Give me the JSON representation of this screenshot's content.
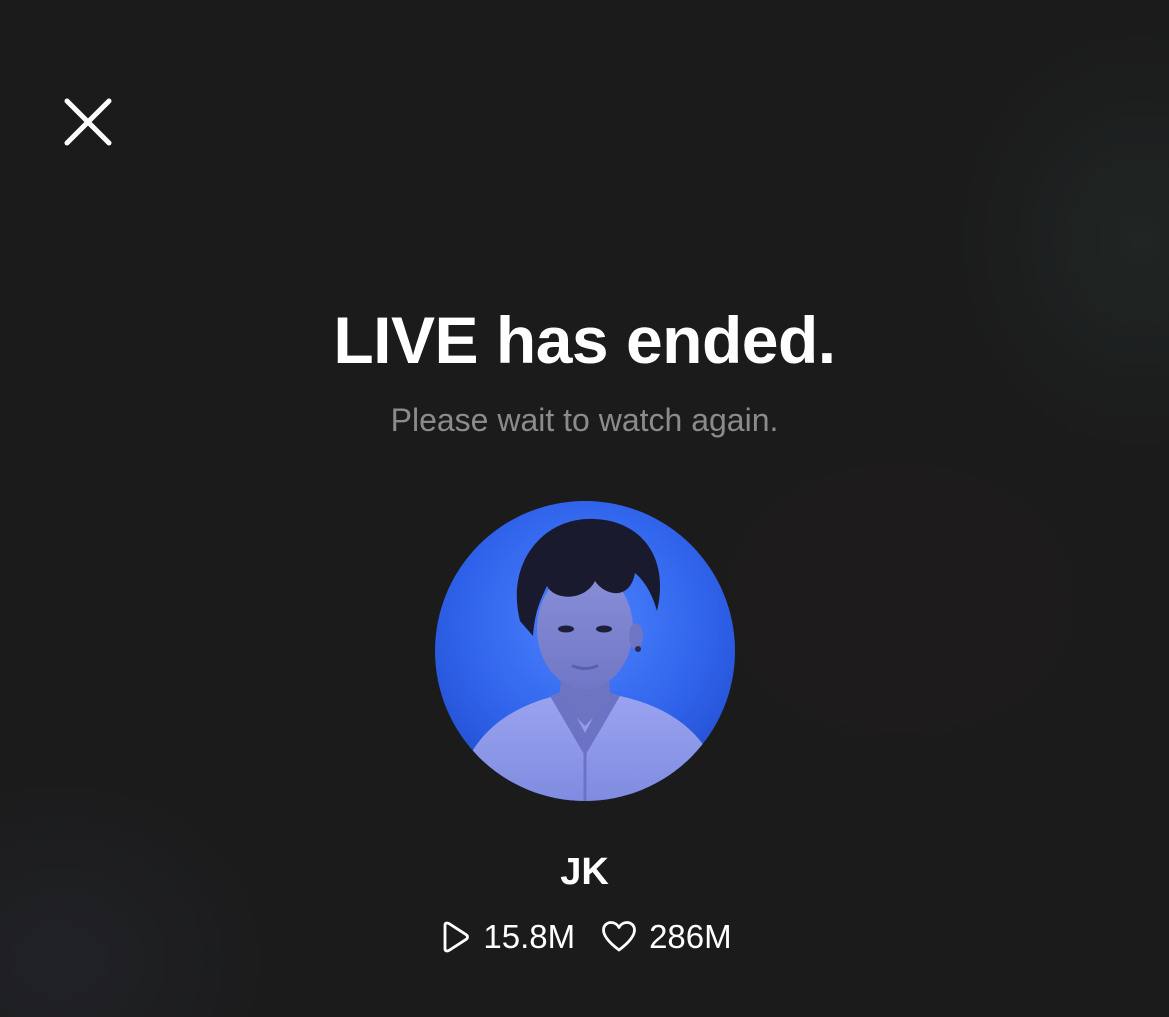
{
  "header": {
    "close_icon": "close-icon"
  },
  "main": {
    "title": "LIVE has ended.",
    "subtitle": "Please wait to watch again."
  },
  "profile": {
    "avatar_accent": "#2f62ea",
    "name": "JK",
    "views_icon": "play-icon",
    "views": "15.8M",
    "likes_icon": "heart-icon",
    "likes": "286M"
  },
  "colors": {
    "background": "#1b1b1c",
    "title": "#ffffff",
    "subtitle": "#8b8b8c"
  }
}
